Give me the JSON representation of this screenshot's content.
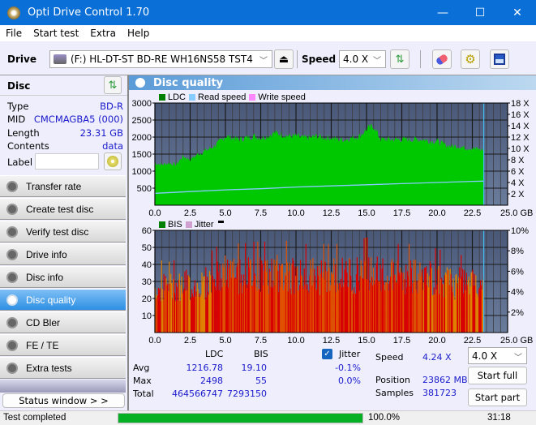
{
  "window": {
    "title": "Opti Drive Control 1.70",
    "minimize": "—",
    "maximize": "☐",
    "close": "✕"
  },
  "menu": [
    "File",
    "Start test",
    "Extra",
    "Help"
  ],
  "toolbar": {
    "drive_label": "Drive",
    "drive_value": "(F:)  HL-DT-ST BD-RE  WH16NS58 TST4",
    "speed_label": "Speed",
    "speed_value": "4.0 X"
  },
  "disc": {
    "header": "Disc",
    "rows": [
      {
        "label": "Type",
        "value": "BD-R"
      },
      {
        "label": "MID",
        "value": "CMCMAGBA5 (000)"
      },
      {
        "label": "Length",
        "value": "23.31 GB"
      },
      {
        "label": "Contents",
        "value": "data"
      }
    ],
    "label_field_label": "Label",
    "label_field_value": ""
  },
  "nav": [
    {
      "label": "Transfer rate",
      "active": false
    },
    {
      "label": "Create test disc",
      "active": false
    },
    {
      "label": "Verify test disc",
      "active": false
    },
    {
      "label": "Drive info",
      "active": false
    },
    {
      "label": "Disc info",
      "active": false
    },
    {
      "label": "Disc quality",
      "active": true
    },
    {
      "label": "CD Bler",
      "active": false
    },
    {
      "label": "FE / TE",
      "active": false
    },
    {
      "label": "Extra tests",
      "active": false
    }
  ],
  "status_window_button": "Status window > >",
  "panel_title": "Disc quality",
  "chart_data": [
    {
      "type": "area",
      "title": "LDC / Read speed",
      "legend": [
        {
          "name": "LDC",
          "color": "#008000"
        },
        {
          "name": "Read speed",
          "color": "#88ccff"
        },
        {
          "name": "Write speed",
          "color": "#ff88ff"
        }
      ],
      "xlabel": "GB",
      "xlim": [
        0,
        25
      ],
      "x_ticks": [
        "0.0",
        "2.5",
        "5.0",
        "7.5",
        "10.0",
        "12.5",
        "15.0",
        "17.5",
        "20.0",
        "22.5",
        "25.0 GB"
      ],
      "ylim": [
        0,
        3000
      ],
      "y_ticks": [
        "500",
        "1000",
        "1500",
        "2000",
        "2500",
        "3000"
      ],
      "y2lim": [
        0,
        18
      ],
      "y2_ticks": [
        "2 X",
        "4 X",
        "6 X",
        "8 X",
        "10 X",
        "12 X",
        "14 X",
        "16 X",
        "18 X"
      ],
      "data_end_gb": 23.31,
      "series": [
        {
          "name": "LDC",
          "x": [
            0,
            0.5,
            1,
            1.5,
            2,
            2.5,
            3,
            3.5,
            4,
            4.5,
            5,
            5.5,
            6,
            6.5,
            7,
            7.5,
            8,
            8.5,
            9,
            9.5,
            10,
            10.5,
            11,
            11.5,
            12,
            12.5,
            13,
            13.5,
            14,
            14.5,
            15,
            15.5,
            16,
            16.5,
            17,
            17.5,
            18,
            18.5,
            19,
            19.5,
            20,
            20.5,
            21,
            21.5,
            22,
            22.5,
            23,
            23.31
          ],
          "values": [
            1250,
            1200,
            1250,
            1200,
            1450,
            1350,
            1500,
            1600,
            1700,
            1850,
            2050,
            2000,
            1950,
            2000,
            2050,
            2000,
            2050,
            2150,
            2100,
            2050,
            2050,
            2000,
            2000,
            2050,
            2000,
            2000,
            1950,
            1950,
            2000,
            2050,
            2250,
            2350,
            1950,
            1950,
            1950,
            1950,
            1950,
            1950,
            1950,
            1900,
            1900,
            1800,
            1750,
            1750,
            1700,
            1700,
            1650,
            1650
          ]
        },
        {
          "name": "Read speed",
          "x": [
            0,
            2.5,
            5,
            7.5,
            10,
            12.5,
            15,
            17.5,
            20,
            22.5,
            23.31
          ],
          "values": [
            2.1,
            2.4,
            2.7,
            2.9,
            3.2,
            3.4,
            3.6,
            3.8,
            4.0,
            4.2,
            4.24
          ]
        }
      ]
    },
    {
      "type": "bar",
      "title": "BIS / Jitter",
      "legend": [
        {
          "name": "BIS",
          "color": "#008000"
        },
        {
          "name": "Jitter",
          "color": "#d0a0d0"
        }
      ],
      "xlabel": "GB",
      "xlim": [
        0,
        25
      ],
      "x_ticks": [
        "0.0",
        "2.5",
        "5.0",
        "7.5",
        "10.0",
        "12.5",
        "15.0",
        "17.5",
        "20.0",
        "22.5",
        "25.0 GB"
      ],
      "ylim": [
        0,
        60
      ],
      "y_ticks": [
        "10",
        "20",
        "30",
        "40",
        "50",
        "60"
      ],
      "y2lim": [
        0,
        10
      ],
      "y2_ticks": [
        "2%",
        "4%",
        "6%",
        "8%",
        "10%"
      ],
      "data_end_gb": 23.31,
      "series": [
        {
          "name": "BIS",
          "x": [
            0,
            1,
            2,
            3,
            4,
            5,
            6,
            7,
            8,
            9,
            10,
            11,
            12,
            13,
            14,
            15,
            16,
            17,
            18,
            19,
            20,
            21,
            22,
            23.31
          ],
          "values": [
            33,
            32,
            34,
            33,
            37,
            42,
            40,
            41,
            41,
            42,
            40,
            40,
            40,
            40,
            41,
            43,
            40,
            40,
            40,
            39,
            38,
            35,
            35,
            33
          ]
        }
      ]
    }
  ],
  "stats": {
    "col_ldc": "LDC",
    "col_bis": "BIS",
    "rows": [
      {
        "label": "Avg",
        "ldc": "1216.78",
        "bis": "19.10",
        "jitter": "-0.1%"
      },
      {
        "label": "Max",
        "ldc": "2498",
        "bis": "55",
        "jitter": "0.0%"
      },
      {
        "label": "Total",
        "ldc": "464566747",
        "bis": "7293150"
      }
    ],
    "jitter_label": "Jitter",
    "jitter_checked": true,
    "speed_label": "Speed",
    "speed_value": "4.24 X",
    "position_label": "Position",
    "position_value": "23862 MB",
    "samples_label": "Samples",
    "samples_value": "381723",
    "speed_select": "4.0 X",
    "start_full": "Start full",
    "start_part": "Start part"
  },
  "statusbar": {
    "text": "Test completed",
    "progress": 100,
    "progress_text": "100.0%",
    "time": "31:18"
  }
}
